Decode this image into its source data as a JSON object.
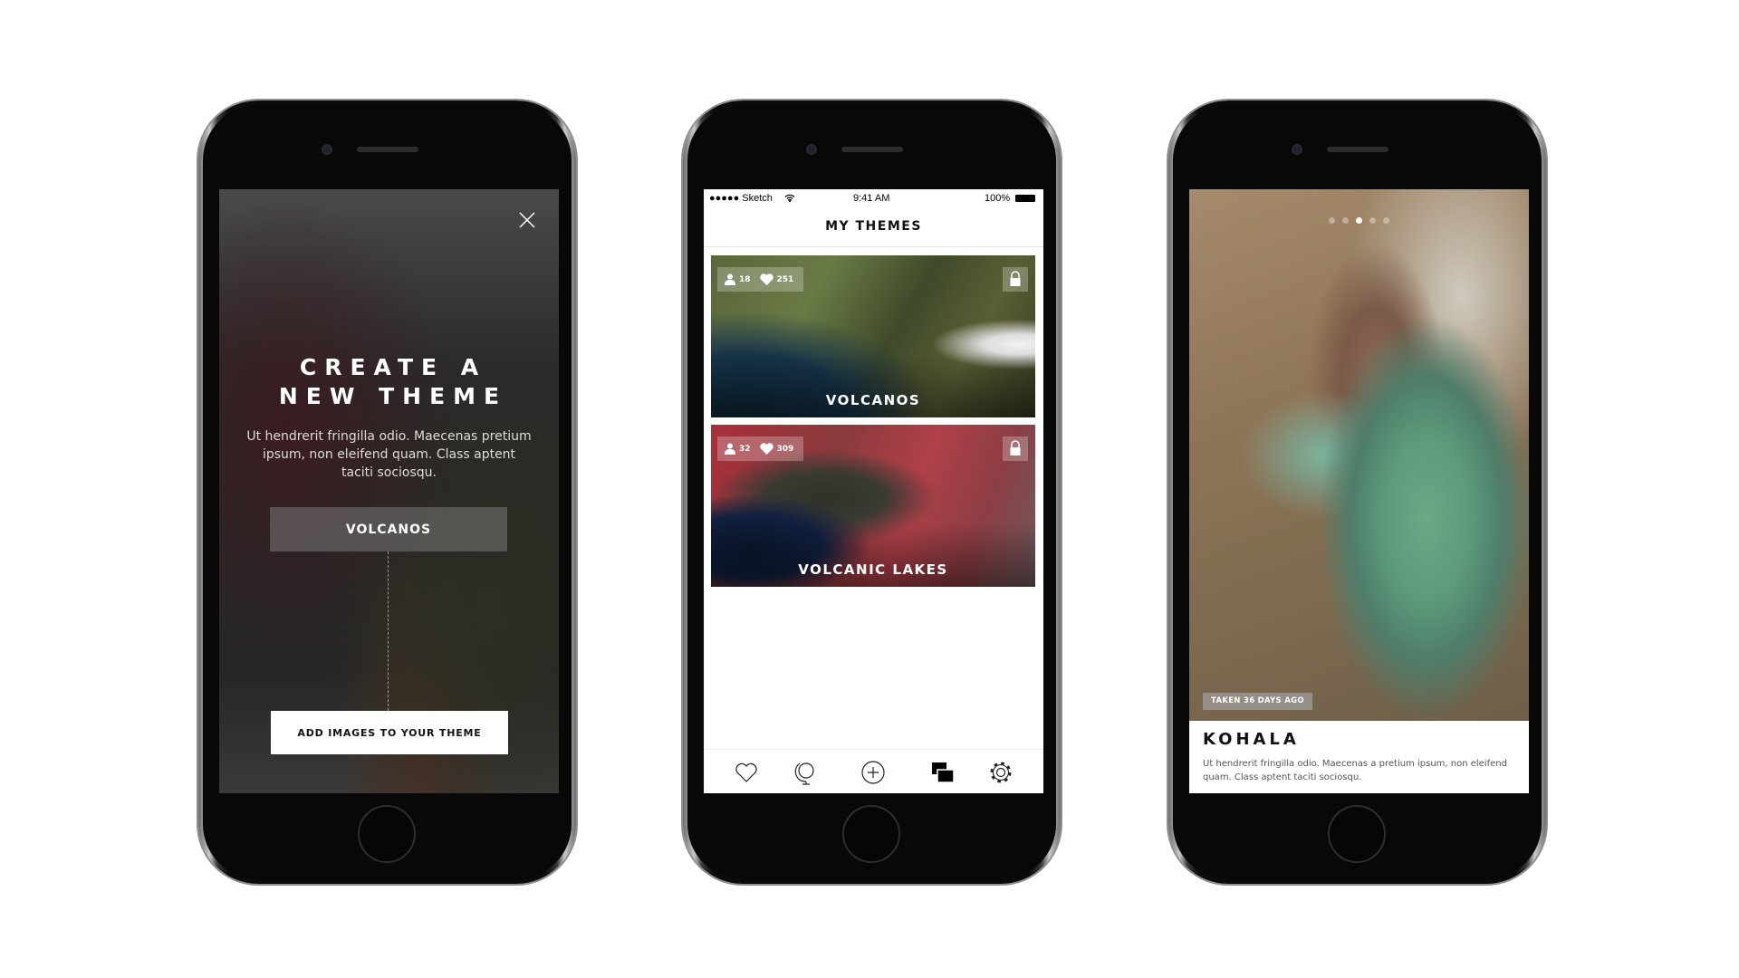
{
  "screen1": {
    "title_line1": "CREATE A",
    "title_line2": "NEW THEME",
    "description": "Ut hendrerit fringilla odio. Maecenas pretium ipsum, non eleifend quam. Class aptent taciti sociosqu.",
    "theme_button": "VOLCANOS",
    "add_images_button": "ADD IMAGES TO YOUR THEME",
    "close_icon": "close-icon"
  },
  "screen2": {
    "status": {
      "carrier": "●●●●● Sketch",
      "time": "9:41 AM",
      "battery": "100%"
    },
    "title": "MY THEMES",
    "cards": [
      {
        "title": "VOLCANOS",
        "followers": "18",
        "likes": "251"
      },
      {
        "title": "VOLCANIC LAKES",
        "followers": "32",
        "likes": "309"
      }
    ],
    "tabs": [
      "heart-icon",
      "globe-icon",
      "add-icon",
      "themes-icon",
      "settings-icon"
    ],
    "active_tab": "themes-icon"
  },
  "screen3": {
    "taken": "TAKEN 36 DAYS AGO",
    "title": "KOHALA",
    "description": "Ut hendrerit fringilla odio. Maecenas a pretium ipsum, non eleifend quam. Class aptent taciti sociosqu.",
    "page_count": 5,
    "active_page": 3
  }
}
